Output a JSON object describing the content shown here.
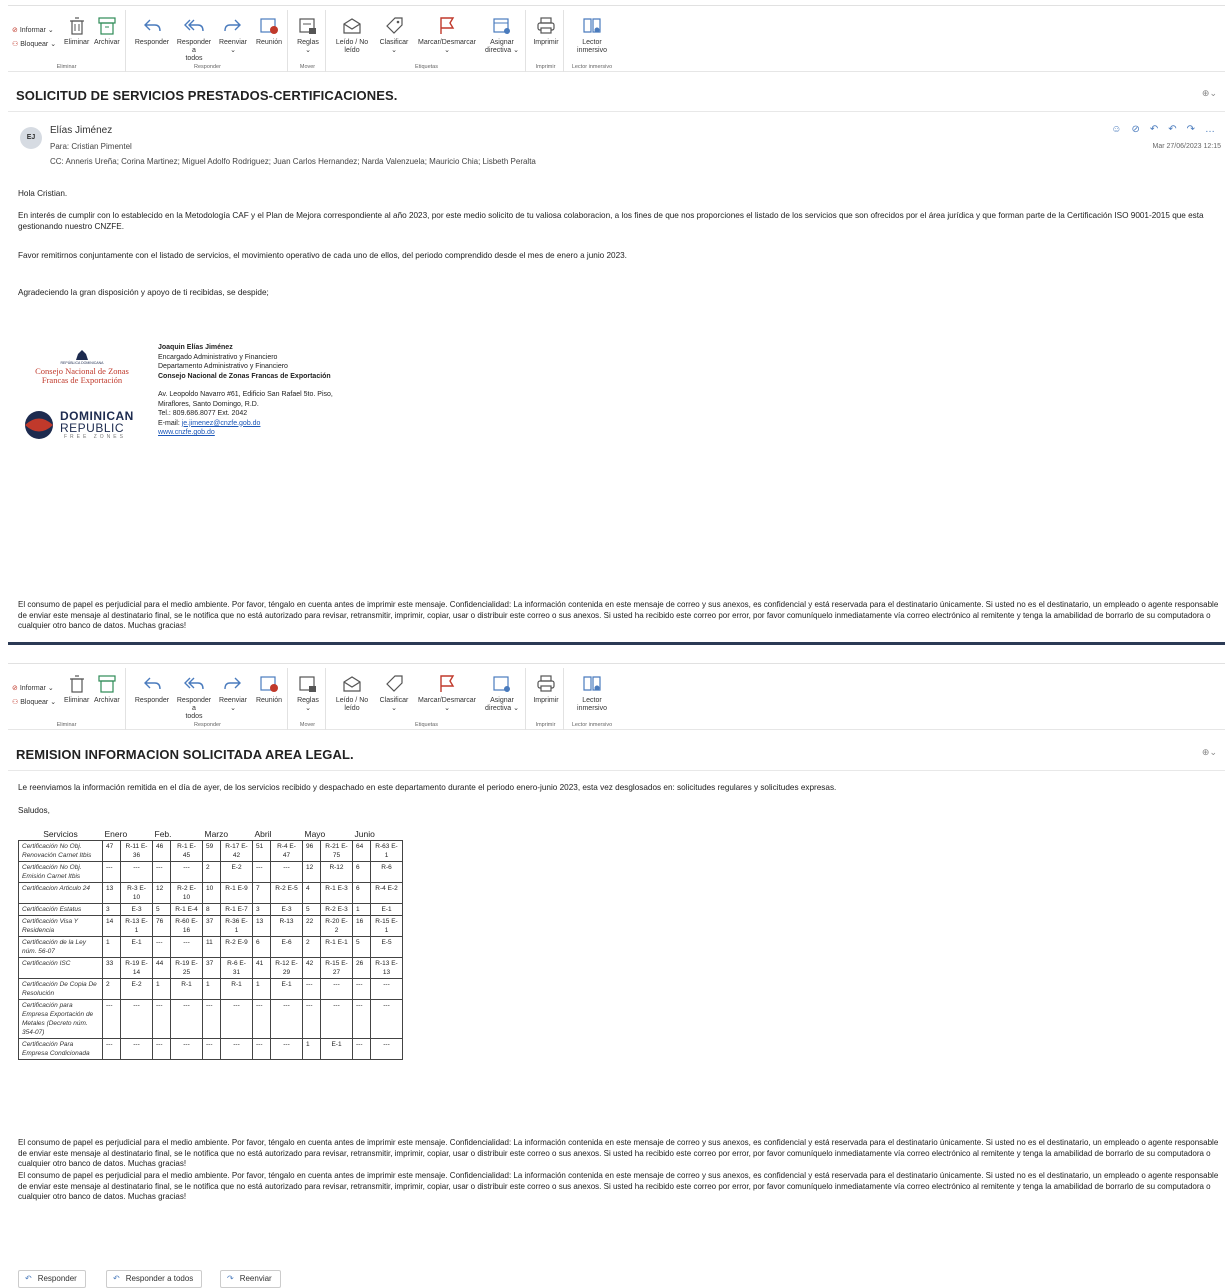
{
  "ribbon": {
    "informar": "Informar",
    "bloquear": "Bloquear",
    "eliminar": "Eliminar",
    "archivar": "Archivar",
    "group_eliminar": "Eliminar",
    "responder": "Responder",
    "responder_todos_1": "Responder a",
    "responder_todos_2": "todos",
    "reenviar": "Reenviar",
    "reunion": "Reunión",
    "group_responder": "Responder",
    "reglas": "Reglas",
    "group_mover": "Mover",
    "leido_1": "Leído / No",
    "leido_2": "leído",
    "clasificar": "Clasificar",
    "marcar": "Marcar/Desmarcar",
    "asignar_1": "Asignar",
    "asignar_2": "directiva",
    "group_etiquetas": "Etiquetas",
    "imprimir": "Imprimir",
    "group_imprimir": "Imprimir",
    "lector_1": "Lector",
    "lector_2": "inmersivo",
    "group_lector": "Lector inmersivo"
  },
  "email1": {
    "subject": "SOLICITUD DE SERVICIOS PRESTADOS-CERTIFICACIONES.",
    "avatar": "EJ",
    "sender": "Elías Jiménez",
    "to": "Para: Cristian Pimentel",
    "cc": "CC: Anneris Ureña; Corina Martinez; Miguel Adolfo Rodriguez; Juan Carlos Hernandez; Narda Valenzuela; Mauricio Chia; Lisbeth Peralta",
    "date": "Mar 27/06/2023 12:15",
    "greeting": "Hola Cristian.",
    "p1": "En interés de cumplir con lo establecido en la Metodología CAF y el Plan de Mejora correspondiente al año 2023, por este medio solicito de tu valiosa colaboracion, a los fines de que nos proporciones el listado de los servicios que son ofrecidos por el área jurídica y que forman parte de la Certificación ISO 9001-2015 que esta gestionando nuestro CNZFE.",
    "p2": "Favor remitirnos conjuntamente con el listado de servicios, el movimiento operativo de cada uno de ellos, del periodo comprendido desde el mes de enero a junio 2023.",
    "p3": "Agradeciendo la gran disposición y apoyo de ti recibidas, se despide;",
    "logo_top": "REPÚBLICA DOMINICANA",
    "logo_cnzfe_1": "Consejo Nacional de Zonas",
    "logo_cnzfe_2": "Francas de Exportación",
    "logo_dr_1": "DOMINICAN",
    "logo_dr_2": "REPUBLIC",
    "logo_dr_3": "FREE ZONES",
    "sig_name": "Joaquin Elías Jiménez",
    "sig_l1": "Encargado Administrativo y Financiero",
    "sig_l2": "Departamento Administrativo y Financiero",
    "sig_l3": "Consejo Nacional de Zonas Francas de Exportación",
    "sig_l4": "Av. Leopoldo Navarro #61, Edificio San Rafael 5to. Piso,",
    "sig_l5": "Miraflores, Santo Domingo, R.D.",
    "sig_l6": "Tel.: 809.686.8077 Ext. 2042",
    "sig_email_label": "E-mail: ",
    "sig_email": "je.jimenez@cnzfe.gob.do",
    "sig_web": "www.cnzfe.gob.do",
    "disclaimer": "El consumo de papel es perjudicial para el medio ambiente. Por favor, téngalo en cuenta antes de imprimir este mensaje. Confidencialidad: La información contenida en este mensaje de correo y sus anexos, es confidencial y está reservada para el destinatario únicamente. Si usted no es el destinatario, un empleado o agente responsable de enviar este mensaje al destinatario final, se le notifica que no está autorizado para revisar, retransmitir, imprimir, copiar, usar o distribuir este correo o sus anexos. Si usted ha recibido este correo por error, por favor comuníquelo inmediatamente vía correo electrónico al remitente y tenga la amabilidad de borrarlo de su computadora o cualquier otro banco de datos. Muchas gracias!"
  },
  "email2": {
    "subject": "REMISION INFORMACION SOLICITADA AREA LEGAL.",
    "p1": "Le reenviamos la información remitida en el día de ayer, de los servicios recibido y despachado en este departamento durante el periodo enero-junio 2023, esta vez desglosados en: solicitudes regulares y solicitudes expresas.",
    "saludos": "Saludos,",
    "table_headers": [
      "Servicios",
      "Enero",
      "Feb.",
      "Marzo",
      "Abril",
      "Mayo",
      "Junio"
    ],
    "rows": [
      [
        "Certificación No Obj. Renovación Carnet Itbis",
        "47",
        "R-11 E-36",
        "46",
        "R-1 E-45",
        "59",
        "R-17 E-42",
        "51",
        "R-4 E-47",
        "96",
        "R-21 E-75",
        "64",
        "R-63 E-1"
      ],
      [
        "Certificación No Obj. Emisión Carnet Itbis",
        "---",
        "---",
        "---",
        "---",
        "2",
        "E-2",
        "---",
        "---",
        "12",
        "R-12",
        "6",
        "R-6"
      ],
      [
        "Certificacion Articulo 24",
        "13",
        "R-3 E-10",
        "12",
        "R-2 E-10",
        "10",
        "R-1 E-9",
        "7",
        "R-2 E-5",
        "4",
        "R-1 E-3",
        "6",
        "R-4 E-2"
      ],
      [
        "Certificación Estatus",
        "3",
        "E-3",
        "5",
        "R-1 E-4",
        "8",
        "R-1 E-7",
        "3",
        "E-3",
        "5",
        "R-2 E-3",
        "1",
        "E-1"
      ],
      [
        "Certificación Visa Y Residencia",
        "14",
        "R-13 E-1",
        "76",
        "R-60 E-16",
        "37",
        "R-36 E-1",
        "13",
        "R-13",
        "22",
        "R-20 E-2",
        "16",
        "R-15 E-1"
      ],
      [
        "Certificación de la Ley núm. 56-07",
        "1",
        "E-1",
        "---",
        "---",
        "11",
        "R-2 E-9",
        "6",
        "E-6",
        "2",
        "R-1 E-1",
        "5",
        "E-5"
      ],
      [
        "Certificación ISC",
        "33",
        "R-19 E-14",
        "44",
        "R-19 E-25",
        "37",
        "R-6 E-31",
        "41",
        "R-12 E-29",
        "42",
        "R-15 E-27",
        "26",
        "R-13 E-13"
      ],
      [
        "Certificación De Copia De Resolución",
        "2",
        "E-2",
        "1",
        "R-1",
        "1",
        "R-1",
        "1",
        "E-1",
        "---",
        "---",
        "---",
        "---"
      ],
      [
        "Certificación para Empresa Exportación de Metales (Decreto núm. 354-07)",
        "---",
        "---",
        "---",
        "---",
        "---",
        "---",
        "---",
        "---",
        "---",
        "---",
        "---",
        "---"
      ],
      [
        "Certificación Para Empresa Condicionada",
        "---",
        "---",
        "---",
        "---",
        "---",
        "---",
        "---",
        "---",
        "1",
        "E-1",
        "---",
        "---"
      ]
    ],
    "disclaimer": "El consumo de papel es perjudicial para el medio ambiente. Por favor, téngalo en cuenta antes de imprimir este mensaje. Confidencialidad: La información contenida en este mensaje de correo y sus anexos, es confidencial y está reservada para el destinatario únicamente. Si usted no es el destinatario, un empleado o agente responsable de enviar este mensaje al destinatario final, se le notifica que no está autorizado para revisar, retransmitir, imprimir, copiar, usar o distribuir este correo o sus anexos. Si usted ha recibido este correo por error, por favor comuníquelo inmediatamente vía correo electrónico al remitente y tenga la amabilidad de borrarlo de su computadora o cualquier otro banco de datos. Muchas gracias!",
    "btn_responder": "Responder",
    "btn_responder_todos": "Responder a todos",
    "btn_reenviar": "Reenviar"
  },
  "icons": [
    "warning-icon",
    "block-icon",
    "trash-icon",
    "archive-icon",
    "reply-icon",
    "reply-all-icon",
    "forward-icon",
    "meeting-icon",
    "rules-icon",
    "envelope-icon",
    "tag-icon",
    "flag-icon",
    "policy-icon",
    "printer-icon",
    "reader-icon",
    "zoom-icon",
    "emoji-icon",
    "more-icon"
  ],
  "colors": {
    "accent": "#4a7bbd",
    "flag": "#c0392b",
    "link": "#1a56b8",
    "cnzfe_red": "#c0392b",
    "dr_navy": "#1d2b4f"
  }
}
